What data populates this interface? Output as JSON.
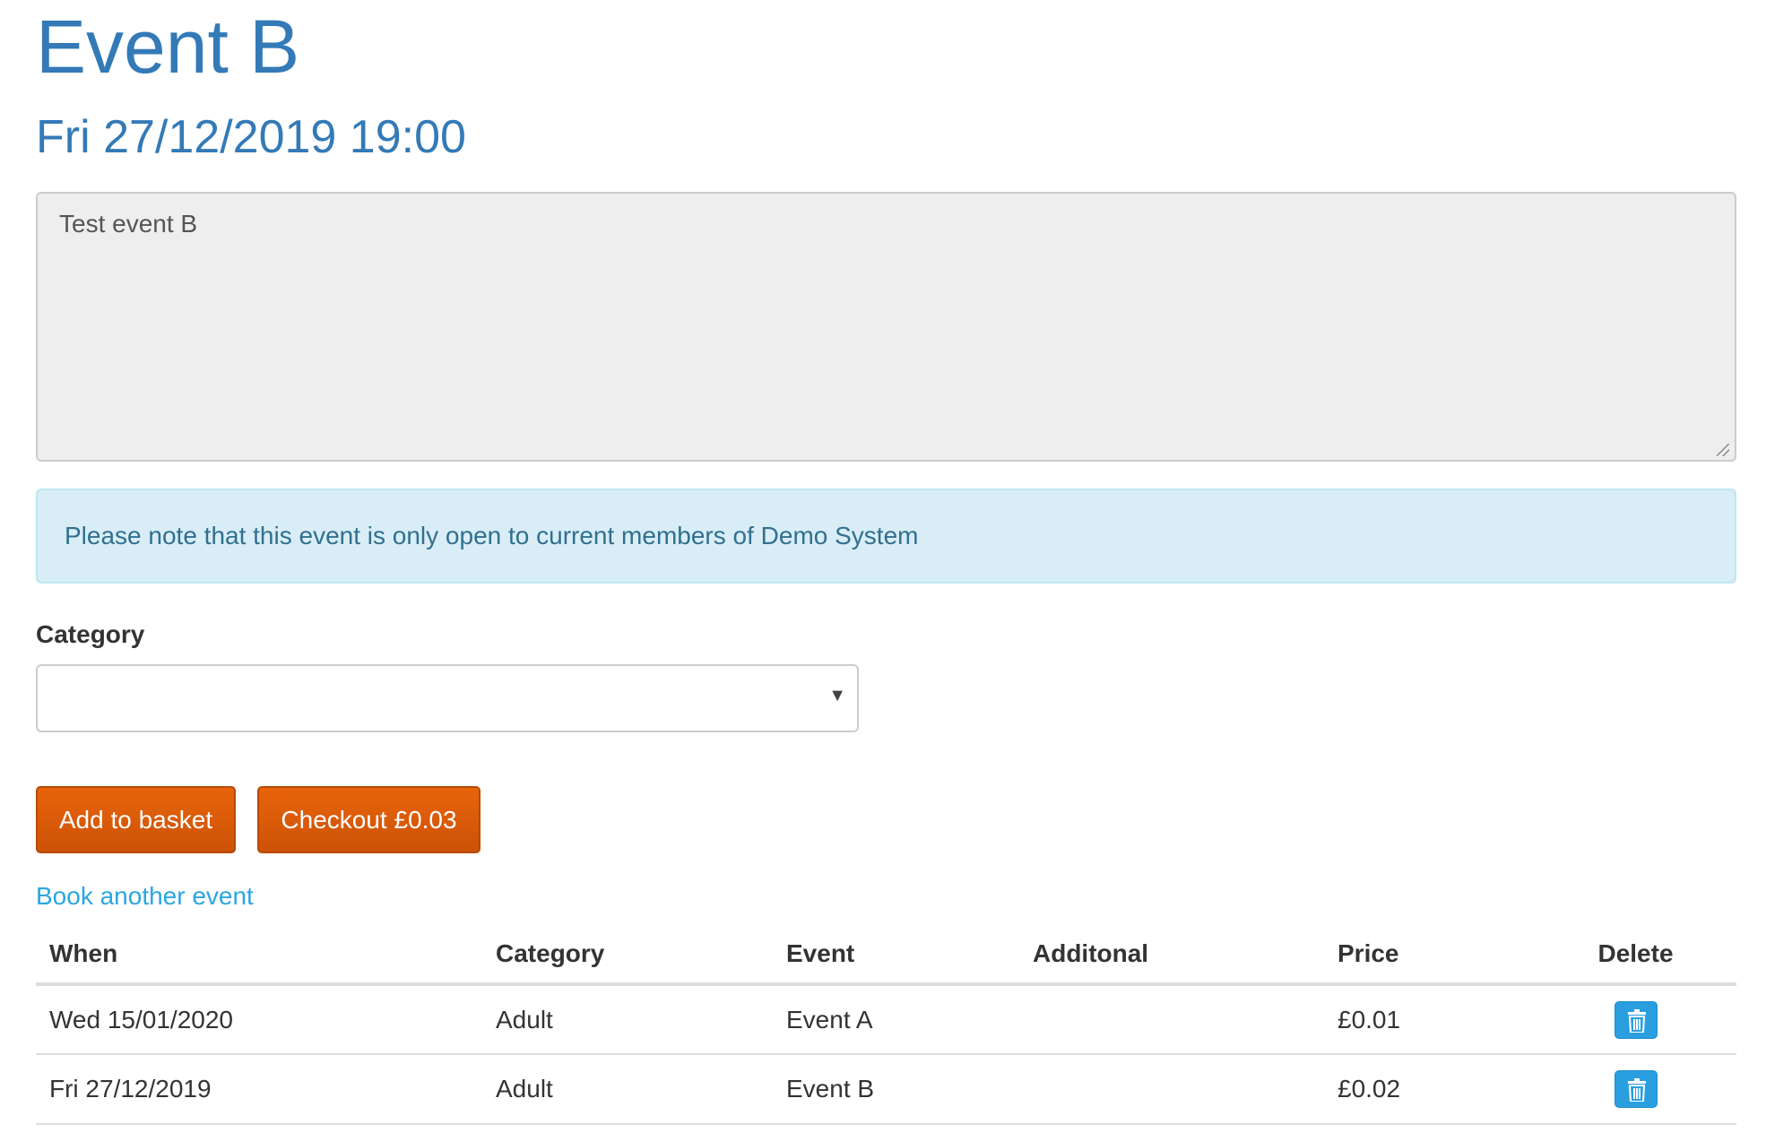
{
  "event": {
    "title": "Event B",
    "datetime": "Fri 27/12/2019 19:00",
    "description": "Test event B"
  },
  "notice": {
    "text": "Please note that this event is only open to current members of Demo System",
    "bg_color": "#d9edf7",
    "text_color": "#31708f"
  },
  "form": {
    "category_label": "Category",
    "category_value": "",
    "add_button": "Add to basket",
    "checkout_button": "Checkout £0.03",
    "accent_color": "#e05a0a"
  },
  "book_another": "Book another event",
  "basket": {
    "columns": [
      "When",
      "Category",
      "Event",
      "Additonal",
      "Price",
      "Delete"
    ],
    "rows": [
      {
        "when": "Wed 15/01/2020",
        "category": "Adult",
        "event": "Event A",
        "additional": "",
        "price": "£0.01",
        "delete_icon": "trash-icon"
      },
      {
        "when": "Fri 27/12/2019",
        "category": "Adult",
        "event": "Event B",
        "additional": "",
        "price": "£0.02",
        "delete_icon": "trash-icon"
      }
    ]
  }
}
